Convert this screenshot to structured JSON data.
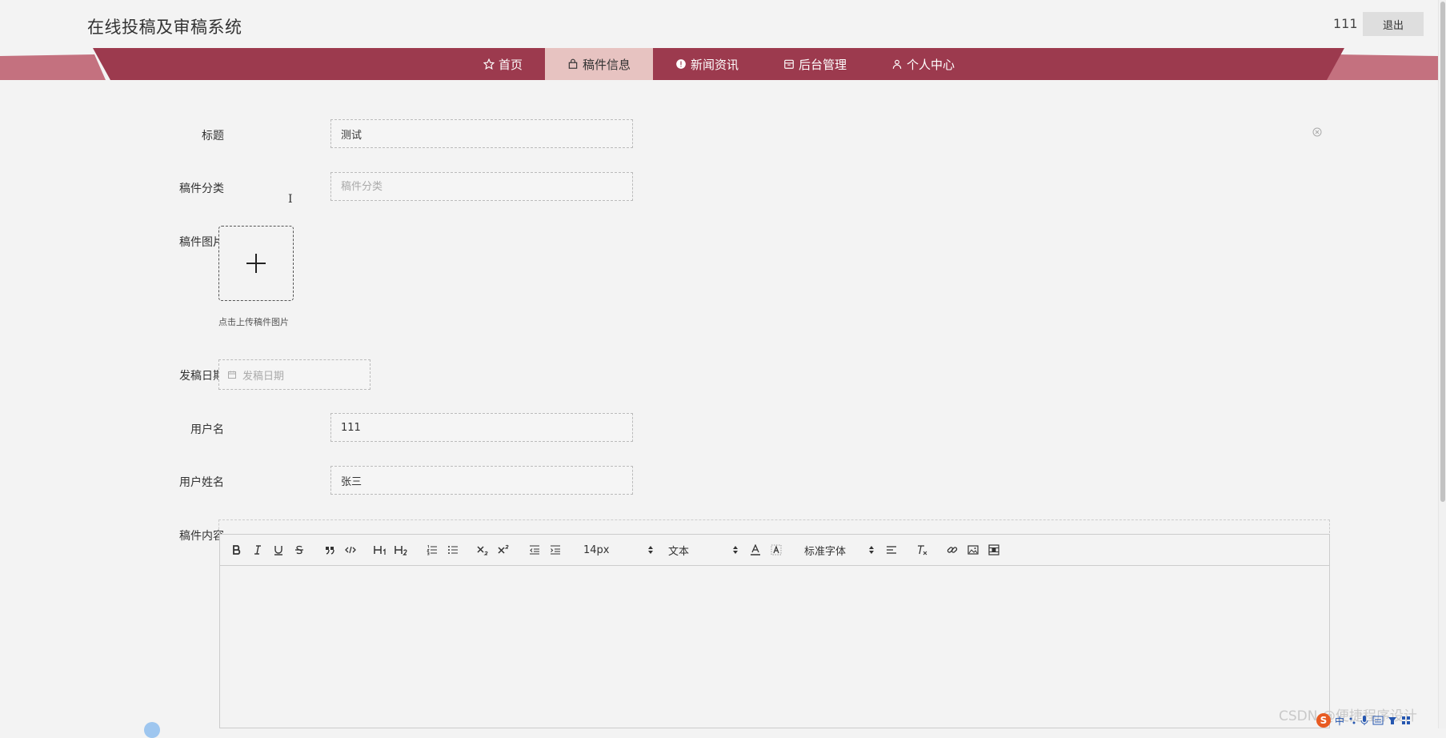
{
  "header": {
    "site_title": "在线投稿及审稿系统",
    "user": "111",
    "logout_label": "退出"
  },
  "nav": {
    "items": [
      {
        "label": "首页",
        "icon": "star-icon",
        "active": false
      },
      {
        "label": "稿件信息",
        "icon": "bag-icon",
        "active": true
      },
      {
        "label": "新闻资讯",
        "icon": "alert-circle-icon",
        "active": false
      },
      {
        "label": "后台管理",
        "icon": "archive-icon",
        "active": false
      },
      {
        "label": "个人中心",
        "icon": "user-icon",
        "active": false
      }
    ]
  },
  "form": {
    "title": {
      "label": "标题",
      "value": "测试"
    },
    "category": {
      "label": "稿件分类",
      "placeholder": "稿件分类"
    },
    "image": {
      "label": "稿件图片",
      "hint": "点击上传稿件图片"
    },
    "date": {
      "label": "发稿日期",
      "placeholder": "发稿日期"
    },
    "username": {
      "label": "用户名",
      "value": "111"
    },
    "realname": {
      "label": "用户姓名",
      "value": "张三"
    },
    "content": {
      "label": "稿件内容"
    }
  },
  "editor": {
    "font_size": "14px",
    "header": "文本",
    "font_family": "标准字体"
  },
  "watermark": "CSDN @便捷程序设计",
  "ime": {
    "logo": "S",
    "mode": "中"
  },
  "colors": {
    "nav_bg": "#9c3a4e",
    "nav_active_bg": "#e7c3c1",
    "nav_side": "#c4717f"
  }
}
